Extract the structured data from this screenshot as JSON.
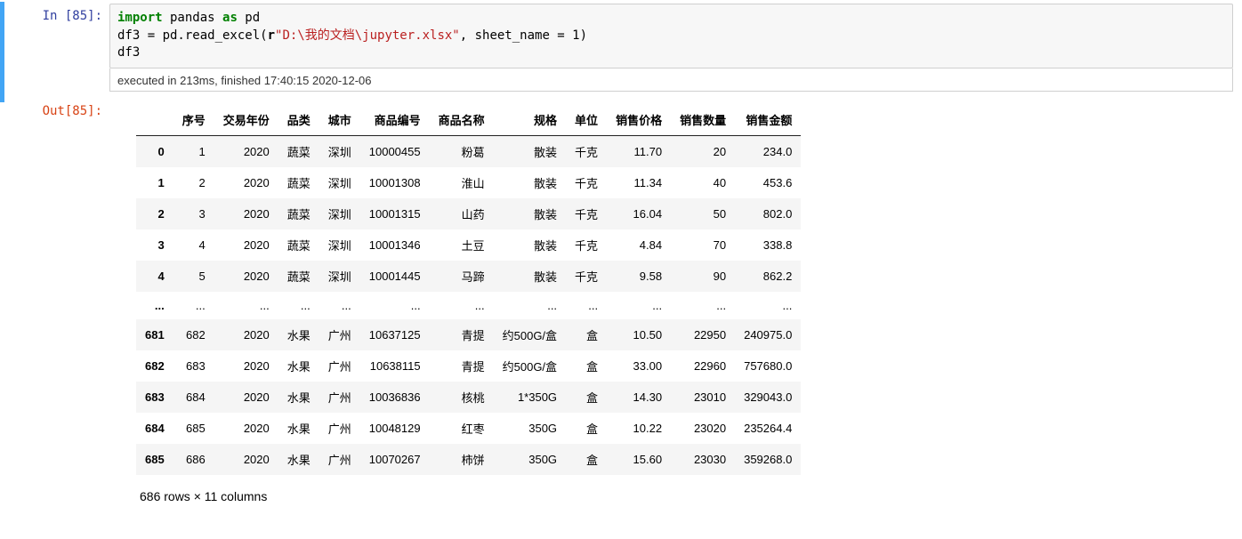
{
  "prompts": {
    "in_label": "In  [85]:",
    "out_label": "Out[85]:"
  },
  "code": {
    "kw_import": "import",
    "mod": " pandas ",
    "kw_as": "as",
    "alias": " pd",
    "line2_a": "df3 = pd.read_excel(",
    "line2_r": "r",
    "line2_str": "\"D:\\我的文档\\jupyter.xlsx\"",
    "line2_b": ", sheet_name = ",
    "line2_num": "1",
    "line2_c": ")",
    "line3": "df3"
  },
  "exec_info": "executed in 213ms, finished 17:40:15 2020-12-06",
  "columns": [
    "序号",
    "交易年份",
    "品类",
    "城市",
    "商品编号",
    "商品名称",
    "规格",
    "单位",
    "销售价格",
    "销售数量",
    "销售金额"
  ],
  "rows": [
    {
      "idx": "0",
      "c": [
        "1",
        "2020",
        "蔬菜",
        "深圳",
        "10000455",
        "粉葛",
        "散装",
        "千克",
        "11.70",
        "20",
        "234.0"
      ]
    },
    {
      "idx": "1",
      "c": [
        "2",
        "2020",
        "蔬菜",
        "深圳",
        "10001308",
        "淮山",
        "散装",
        "千克",
        "11.34",
        "40",
        "453.6"
      ]
    },
    {
      "idx": "2",
      "c": [
        "3",
        "2020",
        "蔬菜",
        "深圳",
        "10001315",
        "山药",
        "散装",
        "千克",
        "16.04",
        "50",
        "802.0"
      ]
    },
    {
      "idx": "3",
      "c": [
        "4",
        "2020",
        "蔬菜",
        "深圳",
        "10001346",
        "土豆",
        "散装",
        "千克",
        "4.84",
        "70",
        "338.8"
      ]
    },
    {
      "idx": "4",
      "c": [
        "5",
        "2020",
        "蔬菜",
        "深圳",
        "10001445",
        "马蹄",
        "散装",
        "千克",
        "9.58",
        "90",
        "862.2"
      ]
    },
    {
      "idx": "...",
      "c": [
        "...",
        "...",
        "...",
        "...",
        "...",
        "...",
        "...",
        "...",
        "...",
        "...",
        "..."
      ]
    },
    {
      "idx": "681",
      "c": [
        "682",
        "2020",
        "水果",
        "广州",
        "10637125",
        "青提",
        "约500G/盒",
        "盒",
        "10.50",
        "22950",
        "240975.0"
      ]
    },
    {
      "idx": "682",
      "c": [
        "683",
        "2020",
        "水果",
        "广州",
        "10638115",
        "青提",
        "约500G/盒",
        "盒",
        "33.00",
        "22960",
        "757680.0"
      ]
    },
    {
      "idx": "683",
      "c": [
        "684",
        "2020",
        "水果",
        "广州",
        "10036836",
        "核桃",
        "1*350G",
        "盒",
        "14.30",
        "23010",
        "329043.0"
      ]
    },
    {
      "idx": "684",
      "c": [
        "685",
        "2020",
        "水果",
        "广州",
        "10048129",
        "红枣",
        "350G",
        "盒",
        "10.22",
        "23020",
        "235264.4"
      ]
    },
    {
      "idx": "685",
      "c": [
        "686",
        "2020",
        "水果",
        "广州",
        "10070267",
        "柿饼",
        "350G",
        "盒",
        "15.60",
        "23030",
        "359268.0"
      ]
    }
  ],
  "footer": "686 rows × 11 columns"
}
